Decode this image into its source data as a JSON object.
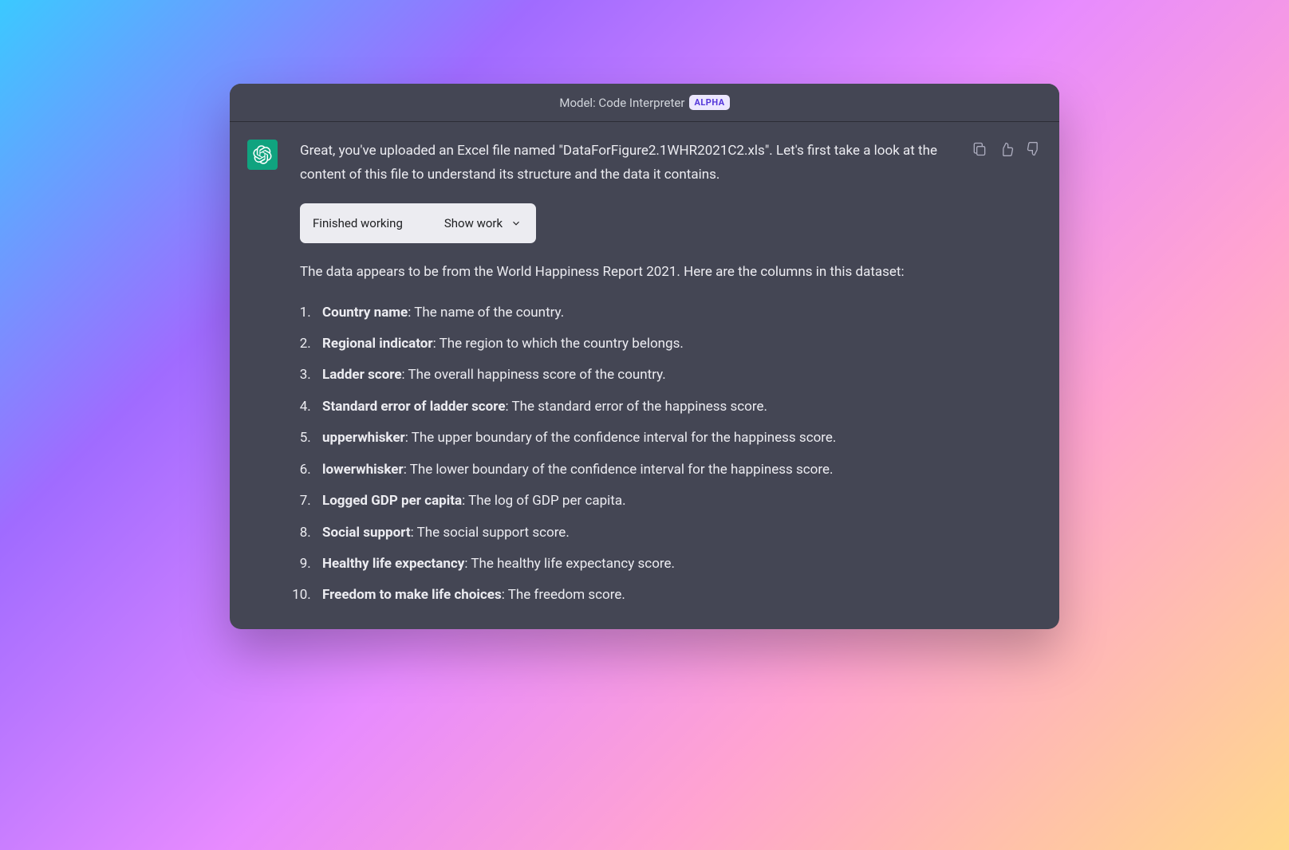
{
  "header": {
    "model_label": "Model: Code Interpreter",
    "badge": "ALPHA"
  },
  "message": {
    "intro": "Great, you've uploaded an Excel file named \"DataForFigure2.1WHR2021C2.xls\". Let's first take a look at the content of this file to understand its structure and the data it contains.",
    "status_pill": {
      "status": "Finished working",
      "show_label": "Show work"
    },
    "summary": "The data appears to be from the World Happiness Report 2021. Here are the columns in this dataset:",
    "columns": [
      {
        "name": "Country name",
        "desc": ": The name of the country."
      },
      {
        "name": "Regional indicator",
        "desc": ": The region to which the country belongs."
      },
      {
        "name": "Ladder score",
        "desc": ": The overall happiness score of the country."
      },
      {
        "name": "Standard error of ladder score",
        "desc": ": The standard error of the happiness score."
      },
      {
        "name": "upperwhisker",
        "desc": ": The upper boundary of the confidence interval for the happiness score."
      },
      {
        "name": "lowerwhisker",
        "desc": ": The lower boundary of the confidence interval for the happiness score."
      },
      {
        "name": "Logged GDP per capita",
        "desc": ": The log of GDP per capita."
      },
      {
        "name": "Social support",
        "desc": ": The social support score."
      },
      {
        "name": "Healthy life expectancy",
        "desc": ": The healthy life expectancy score."
      },
      {
        "name": "Freedom to make life choices",
        "desc": ": The freedom score."
      }
    ]
  },
  "icons": {
    "copy": "copy-icon",
    "thumbs_up": "thumbs-up-icon",
    "thumbs_down": "thumbs-down-icon",
    "chevron": "chevron-down-icon",
    "logo": "openai-logo-icon"
  }
}
